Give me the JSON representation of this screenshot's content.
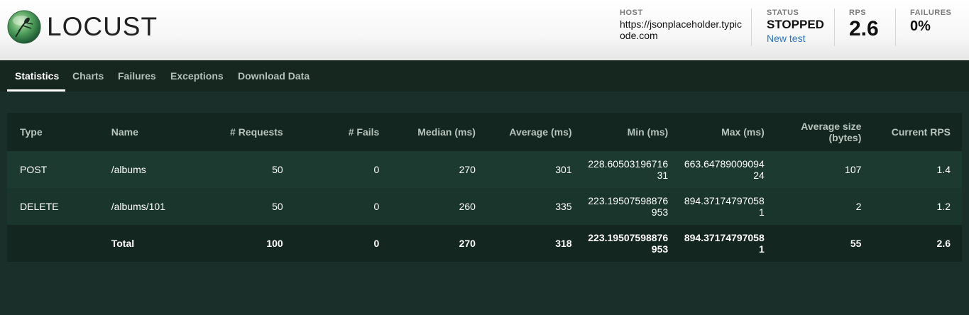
{
  "header": {
    "logo_text": "LOCUST",
    "host": {
      "label": "HOST",
      "value": "https://jsonplaceholder.typicode.com"
    },
    "status": {
      "label": "STATUS",
      "value": "STOPPED",
      "new_test": "New test"
    },
    "rps": {
      "label": "RPS",
      "value": "2.6"
    },
    "failures": {
      "label": "FAILURES",
      "value": "0%"
    }
  },
  "tabs": [
    {
      "label": "Statistics",
      "active": true
    },
    {
      "label": "Charts",
      "active": false
    },
    {
      "label": "Failures",
      "active": false
    },
    {
      "label": "Exceptions",
      "active": false
    },
    {
      "label": "Download Data",
      "active": false
    }
  ],
  "table": {
    "headers": [
      "Type",
      "Name",
      "# Requests",
      "# Fails",
      "Median (ms)",
      "Average (ms)",
      "Min (ms)",
      "Max (ms)",
      "Average size (bytes)",
      "Current RPS"
    ],
    "rows": [
      [
        "POST",
        "/albums",
        "50",
        "0",
        "270",
        "301",
        "228.6050319671631",
        "663.6478900909424",
        "107",
        "1.4"
      ],
      [
        "DELETE",
        "/albums/101",
        "50",
        "0",
        "260",
        "335",
        "223.19507598876953",
        "894.371747970581",
        "2",
        "1.2"
      ]
    ],
    "total": [
      "",
      "Total",
      "100",
      "0",
      "270",
      "318",
      "223.19507598876953",
      "894.371747970581",
      "55",
      "2.6"
    ]
  },
  "colors": {
    "background": "#1a2f29",
    "header_row": "#142620",
    "link": "#2a75c9"
  }
}
